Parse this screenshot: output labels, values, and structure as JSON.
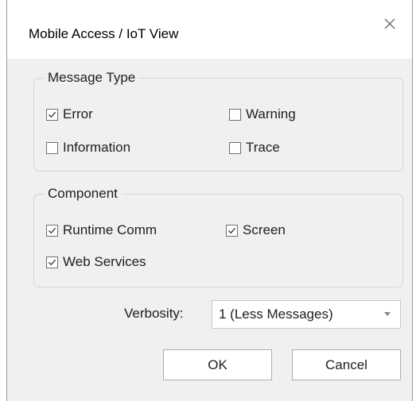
{
  "window": {
    "title": "Mobile Access / IoT View",
    "close_icon": "close-icon"
  },
  "message_type": {
    "legend": "Message Type",
    "options": [
      {
        "label": "Error",
        "checked": true
      },
      {
        "label": "Warning",
        "checked": false
      },
      {
        "label": "Information",
        "checked": false
      },
      {
        "label": "Trace",
        "checked": false
      }
    ]
  },
  "component": {
    "legend": "Component",
    "options": [
      {
        "label": "Runtime Comm",
        "checked": true
      },
      {
        "label": "Screen",
        "checked": true
      },
      {
        "label": "Web Services",
        "checked": true
      }
    ]
  },
  "verbosity": {
    "label": "Verbosity:",
    "value": "1 (Less Messages)"
  },
  "buttons": {
    "ok": "OK",
    "cancel": "Cancel"
  },
  "colors": {
    "dialog_bg": "#f0f0f0",
    "titlebar_bg": "#ffffff",
    "check_color": "#333333"
  }
}
